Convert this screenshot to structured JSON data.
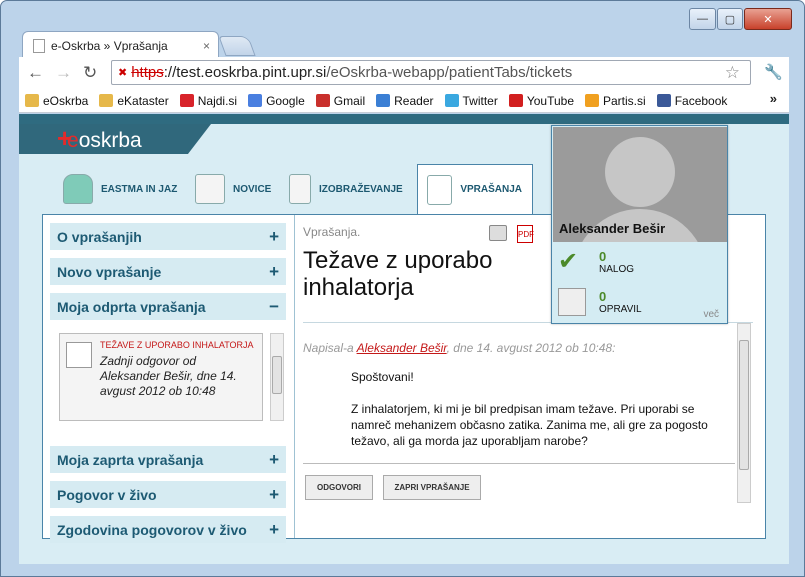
{
  "tab": {
    "title": "e-Oskrba » Vprašanja",
    "close": "×"
  },
  "window": {
    "minimize": "—",
    "maximize": "▢",
    "close": "✕"
  },
  "nav": {
    "back": "←",
    "forward": "→",
    "reload": "↻",
    "star": "☆",
    "wrench": "🔧"
  },
  "address": {
    "scheme": "https",
    "rest": "://test.eoskrba.pint.upr.si",
    "path": "/eOskrba-webapp/patientTabs/tickets"
  },
  "bookmarks": [
    {
      "label": "eOskrba",
      "icon": "folder-icon",
      "color": "#e6b84a"
    },
    {
      "label": "eKataster",
      "icon": "folder-icon",
      "color": "#e6b84a"
    },
    {
      "label": "Najdi.si",
      "icon": "najdi-icon",
      "color": "#d8232a"
    },
    {
      "label": "Google",
      "icon": "google-icon",
      "color": "#4a7fe0"
    },
    {
      "label": "Gmail",
      "icon": "gmail-icon",
      "color": "#c9302c"
    },
    {
      "label": "Reader",
      "icon": "reader-icon",
      "color": "#3b7fd4"
    },
    {
      "label": "Twitter",
      "icon": "twitter-icon",
      "color": "#3aa8e0"
    },
    {
      "label": "YouTube",
      "icon": "youtube-icon",
      "color": "#d21f1f"
    },
    {
      "label": "Partis.si",
      "icon": "partis-icon",
      "color": "#f0a020"
    },
    {
      "label": "Facebook",
      "icon": "facebook-icon",
      "color": "#3b5998"
    }
  ],
  "bookmarks_more": "»",
  "logo": {
    "plus": "+",
    "e": "e",
    "rest": "oskrba"
  },
  "tabs": [
    {
      "label": "EASTMA IN JAZ"
    },
    {
      "label": "NOVICE"
    },
    {
      "label": "IZOBRAŽEVANJE"
    },
    {
      "label": "VPRAŠANJA"
    }
  ],
  "accordion": {
    "o_vprasanjih": "O vprašanjih",
    "novo": "Novo vprašanje",
    "odprta": "Moja odprta vprašanja",
    "zaprta": "Moja zaprta vprašanja",
    "pogovor": "Pogovor v živo",
    "zgodovina": "Zgodovina pogovorov v živo",
    "plus": "+",
    "minus": "−"
  },
  "ticket": {
    "title": "TEŽAVE Z UPORABO INHALATORJA",
    "desc": "Zadnji odgovor od Aleksander Bešir, dne 14. avgust 2012 ob 10:48"
  },
  "main": {
    "crumb": "Vprašanja.",
    "title": "Težave z uporabo inhalatorja",
    "meta_prefix": "Napisal-a",
    "meta_author": "Aleksander Bešir",
    "meta_suffix": ", dne 14. avgust 2012 ob 10:48:",
    "greeting": "Spoštovani!",
    "body": "Z inhalatorjem, ki mi je bil predpisan imam težave. Pri uporabi se namreč mehanizem občasno zatika. Zanima me, ali gre za pogosto težavo, ali ga morda jaz uporabljam narobe?",
    "reply": "ODGOVORI",
    "close": "ZAPRI VPRAŠANJE"
  },
  "profile": {
    "name": "Aleksander Bešir",
    "nalog_count": "0",
    "nalog_label": "NALOG",
    "opravil_count": "0",
    "opravil_label": "OPRAVIL",
    "more": "več"
  }
}
